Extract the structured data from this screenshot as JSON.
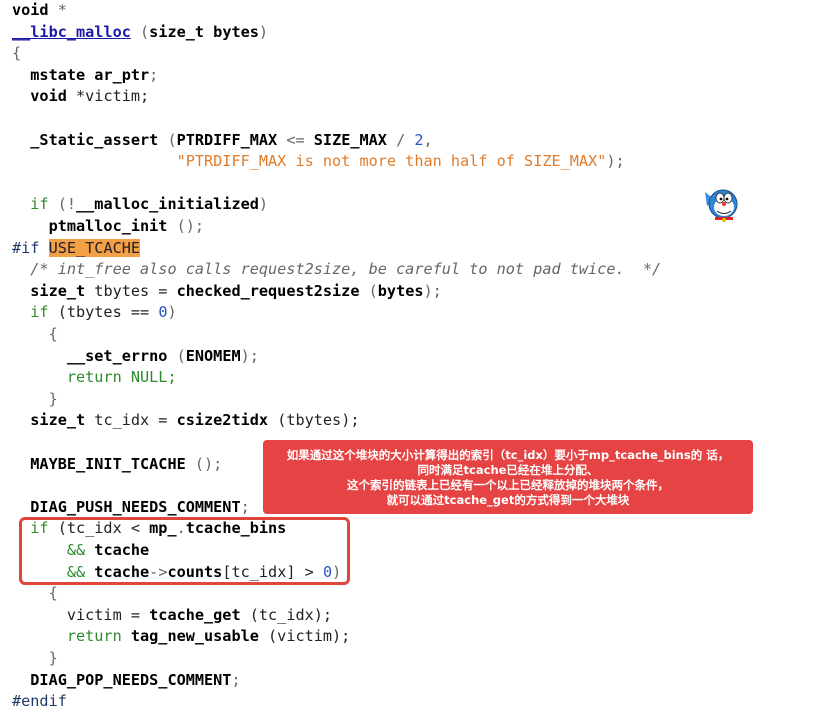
{
  "code_lines": [
    [
      {
        "t": "void ",
        "c": "kw"
      },
      {
        "t": "*",
        "c": "punct"
      }
    ],
    [
      {
        "t": "__libc_malloc",
        "c": "fn"
      },
      {
        "t": " (",
        "c": "punct"
      },
      {
        "t": "size_t bytes",
        "c": "kw"
      },
      {
        "t": ")",
        "c": "punct"
      }
    ],
    [
      {
        "t": "{",
        "c": "punct"
      }
    ],
    [
      {
        "t": "  mstate ar_ptr",
        "c": "kw"
      },
      {
        "t": ";",
        "c": "punct"
      }
    ],
    [
      {
        "t": "  void ",
        "c": "kw"
      },
      {
        "t": "*victim;",
        "c": "plain"
      }
    ],
    [
      {
        "t": "",
        "c": "plain"
      }
    ],
    [
      {
        "t": "  _Static_assert ",
        "c": "kw"
      },
      {
        "t": "(",
        "c": "punct"
      },
      {
        "t": "PTRDIFF_MAX ",
        "c": "macro"
      },
      {
        "t": "<= ",
        "c": "punct"
      },
      {
        "t": "SIZE_MAX ",
        "c": "macro"
      },
      {
        "t": "/ ",
        "c": "punct"
      },
      {
        "t": "2",
        "c": "num"
      },
      {
        "t": ",",
        "c": "punct"
      }
    ],
    [
      {
        "t": "                  ",
        "c": "plain"
      },
      {
        "t": "\"PTRDIFF_MAX is not more than half of SIZE_MAX\"",
        "c": "str"
      },
      {
        "t": ");",
        "c": "punct"
      }
    ],
    [
      {
        "t": "",
        "c": "plain"
      }
    ],
    [
      {
        "t": "  if ",
        "c": "green"
      },
      {
        "t": "(!",
        "c": "punct"
      },
      {
        "t": "__malloc_initialized",
        "c": "kw"
      },
      {
        "t": ")",
        "c": "punct"
      }
    ],
    [
      {
        "t": "    ptmalloc_init ",
        "c": "kw"
      },
      {
        "t": "();",
        "c": "punct"
      }
    ],
    [
      {
        "t": "#if ",
        "c": "pp"
      },
      {
        "t": "USE_TCACHE",
        "c": "hl"
      }
    ],
    [
      {
        "t": "  /* int_free also calls request2size, be careful to not pad twice.  */",
        "c": "cmt"
      }
    ],
    [
      {
        "t": "  size_t ",
        "c": "kw"
      },
      {
        "t": "tbytes = ",
        "c": "plain"
      },
      {
        "t": "checked_request2size ",
        "c": "kw"
      },
      {
        "t": "(",
        "c": "punct"
      },
      {
        "t": "bytes",
        "c": "kw"
      },
      {
        "t": ");",
        "c": "punct"
      }
    ],
    [
      {
        "t": "  if ",
        "c": "green"
      },
      {
        "t": "(tbytes == ",
        "c": "plain"
      },
      {
        "t": "0",
        "c": "num"
      },
      {
        "t": ")",
        "c": "punct"
      }
    ],
    [
      {
        "t": "    {",
        "c": "punct"
      }
    ],
    [
      {
        "t": "      __set_errno ",
        "c": "kw"
      },
      {
        "t": "(",
        "c": "punct"
      },
      {
        "t": "ENOMEM",
        "c": "macro"
      },
      {
        "t": ");",
        "c": "punct"
      }
    ],
    [
      {
        "t": "      return NULL;",
        "c": "green"
      }
    ],
    [
      {
        "t": "    }",
        "c": "punct"
      }
    ],
    [
      {
        "t": "  size_t ",
        "c": "kw"
      },
      {
        "t": "tc_idx = ",
        "c": "plain"
      },
      {
        "t": "csize2tidx ",
        "c": "kw"
      },
      {
        "t": "(tbytes);",
        "c": "plain"
      }
    ],
    [
      {
        "t": "",
        "c": "plain"
      }
    ],
    [
      {
        "t": "  MAYBE_INIT_TCACHE ",
        "c": "macro"
      },
      {
        "t": "();",
        "c": "punct"
      }
    ],
    [
      {
        "t": "",
        "c": "plain"
      }
    ],
    [
      {
        "t": "  DIAG_PUSH_NEEDS_COMMENT",
        "c": "macro"
      },
      {
        "t": ";",
        "c": "punct"
      }
    ],
    [
      {
        "t": "  if ",
        "c": "green"
      },
      {
        "t": "(tc_idx < ",
        "c": "plain"
      },
      {
        "t": "mp_",
        "c": "kw"
      },
      {
        "t": ".",
        "c": "punct"
      },
      {
        "t": "tcache_bins",
        "c": "kw"
      }
    ],
    [
      {
        "t": "      && ",
        "c": "green"
      },
      {
        "t": "tcache",
        "c": "kw"
      }
    ],
    [
      {
        "t": "      && ",
        "c": "green"
      },
      {
        "t": "tcache",
        "c": "kw"
      },
      {
        "t": "->",
        "c": "punct"
      },
      {
        "t": "counts",
        "c": "kw"
      },
      {
        "t": "[tc_idx] > ",
        "c": "plain"
      },
      {
        "t": "0",
        "c": "num"
      },
      {
        "t": ")",
        "c": "punct"
      }
    ],
    [
      {
        "t": "    {",
        "c": "punct"
      }
    ],
    [
      {
        "t": "      victim = ",
        "c": "plain"
      },
      {
        "t": "tcache_get ",
        "c": "kw"
      },
      {
        "t": "(tc_idx);",
        "c": "plain"
      }
    ],
    [
      {
        "t": "      return ",
        "c": "green"
      },
      {
        "t": "tag_new_usable ",
        "c": "kw"
      },
      {
        "t": "(victim);",
        "c": "plain"
      }
    ],
    [
      {
        "t": "    }",
        "c": "punct"
      }
    ],
    [
      {
        "t": "  DIAG_POP_NEEDS_COMMENT",
        "c": "macro"
      },
      {
        "t": ";",
        "c": "punct"
      }
    ],
    [
      {
        "t": "#endif",
        "c": "pp"
      }
    ]
  ],
  "annotation": {
    "line1": "如果通过这个堆块的大小计算得出的索引（tc_idx）要小于mp_tcache_bins的 话，",
    "line2": "同时满足tcache已经在堆上分配、",
    "line3": "这个索引的链表上已经有一个以上已经释放掉的堆块两个条件，",
    "line4": "就可以通过tcache_get的方式得到一个大堆块"
  },
  "colors": {
    "annotation_bg": "#e64444",
    "highlight_border": "#e0443a",
    "macro_highlight": "#f4a046"
  },
  "icons": {
    "mascot": "doraemon-icon"
  }
}
